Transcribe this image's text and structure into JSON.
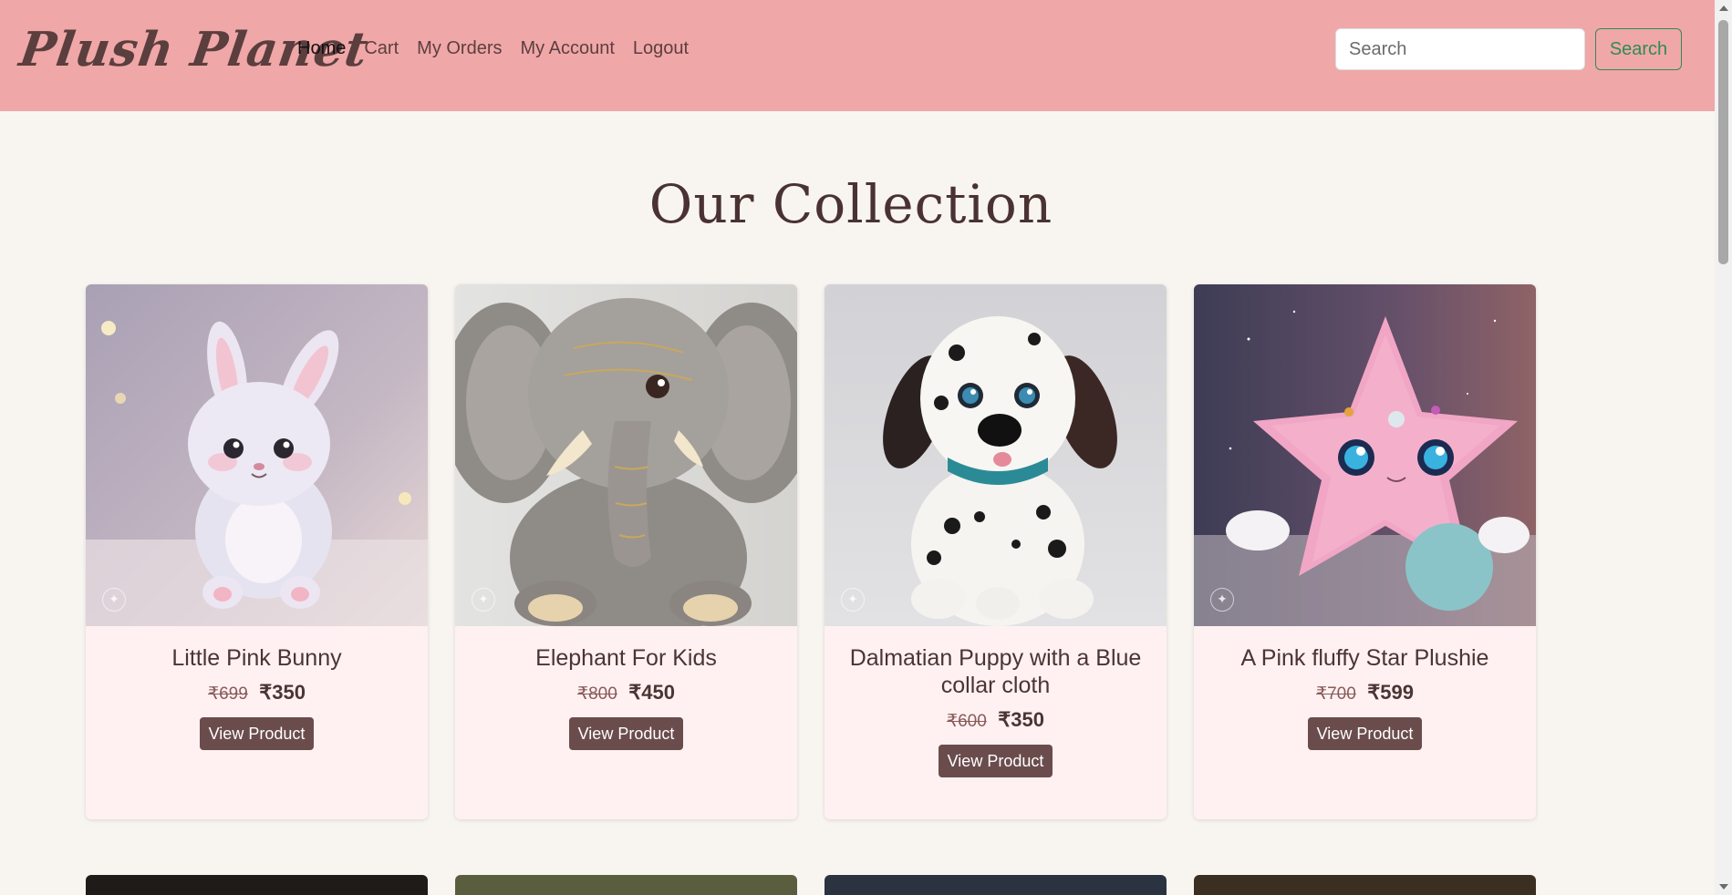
{
  "navbar": {
    "brand": "Plush Planet",
    "links": [
      {
        "label": "Home",
        "active": true
      },
      {
        "label": "Cart",
        "active": false
      },
      {
        "label": "My Orders",
        "active": false
      },
      {
        "label": "My Account",
        "active": false
      },
      {
        "label": "Logout",
        "active": false
      }
    ],
    "search_placeholder": "Search",
    "search_button": "Search"
  },
  "page": {
    "heading": "Our Collection"
  },
  "products": [
    {
      "name": "Little Pink Bunny",
      "old_price": "₹699",
      "price": "₹350",
      "button": "View Product",
      "image_icon": "pink-bunny-plush"
    },
    {
      "name": "Elephant For Kids",
      "old_price": "₹800",
      "price": "₹450",
      "button": "View Product",
      "image_icon": "grey-elephant-plush"
    },
    {
      "name": "Dalmatian Puppy with a Blue collar cloth",
      "old_price": "₹600",
      "price": "₹350",
      "button": "View Product",
      "image_icon": "dalmatian-puppy-plush"
    },
    {
      "name": "A Pink fluffy Star Plushie",
      "old_price": "₹700",
      "price": "₹599",
      "button": "View Product",
      "image_icon": "pink-star-plush"
    }
  ],
  "colors": {
    "navbar_bg": "#f0a7a8",
    "page_bg": "#f8f5f1",
    "card_bg": "#fff1f1",
    "button_bg": "#6b4c4c",
    "search_accent": "#2e8b57"
  }
}
